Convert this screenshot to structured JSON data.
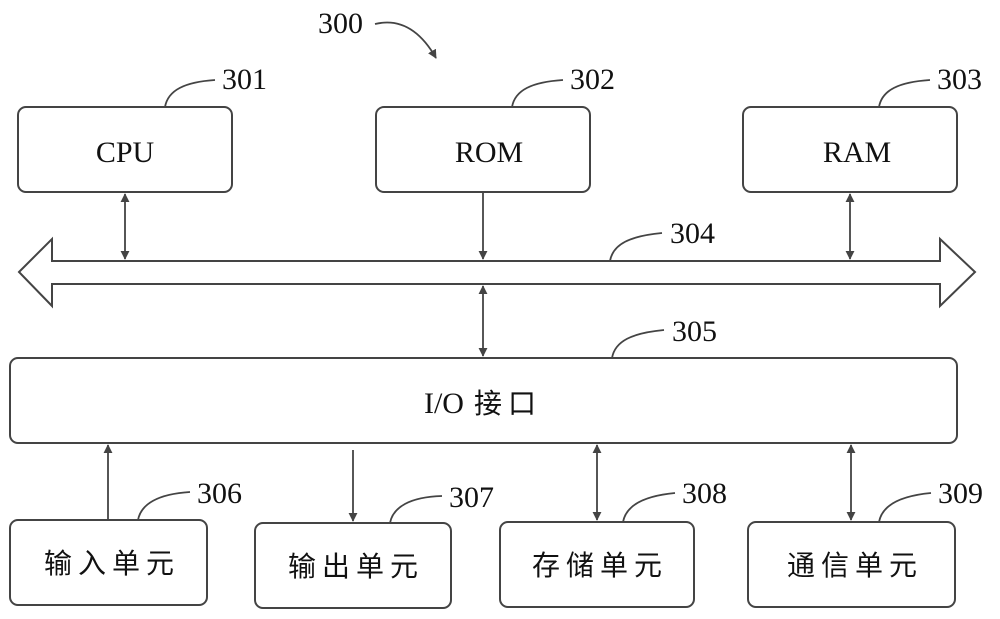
{
  "figure": {
    "ref": "300",
    "components": [
      {
        "id": "cpu",
        "ref": "301",
        "label": "CPU"
      },
      {
        "id": "rom",
        "ref": "302",
        "label": "ROM"
      },
      {
        "id": "ram",
        "ref": "303",
        "label": "RAM"
      },
      {
        "id": "bus",
        "ref": "304",
        "label": ""
      },
      {
        "id": "io",
        "ref": "305",
        "label_latin": "I/O",
        "label_cjk": "接口"
      },
      {
        "id": "input",
        "ref": "306",
        "label": "输入单元"
      },
      {
        "id": "output",
        "ref": "307",
        "label": "输出单元"
      },
      {
        "id": "storage",
        "ref": "308",
        "label": "存储单元"
      },
      {
        "id": "comm",
        "ref": "309",
        "label": "通信单元"
      }
    ],
    "connections": [
      {
        "from": "cpu",
        "to": "bus",
        "direction": "bidirectional"
      },
      {
        "from": "rom",
        "to": "bus",
        "direction": "one-way"
      },
      {
        "from": "ram",
        "to": "bus",
        "direction": "bidirectional"
      },
      {
        "from": "bus",
        "to": "io",
        "direction": "bidirectional"
      },
      {
        "from": "input",
        "to": "io",
        "direction": "one-way"
      },
      {
        "from": "io",
        "to": "output",
        "direction": "one-way"
      },
      {
        "from": "io",
        "to": "storage",
        "direction": "bidirectional"
      },
      {
        "from": "io",
        "to": "comm",
        "direction": "bidirectional"
      }
    ]
  }
}
